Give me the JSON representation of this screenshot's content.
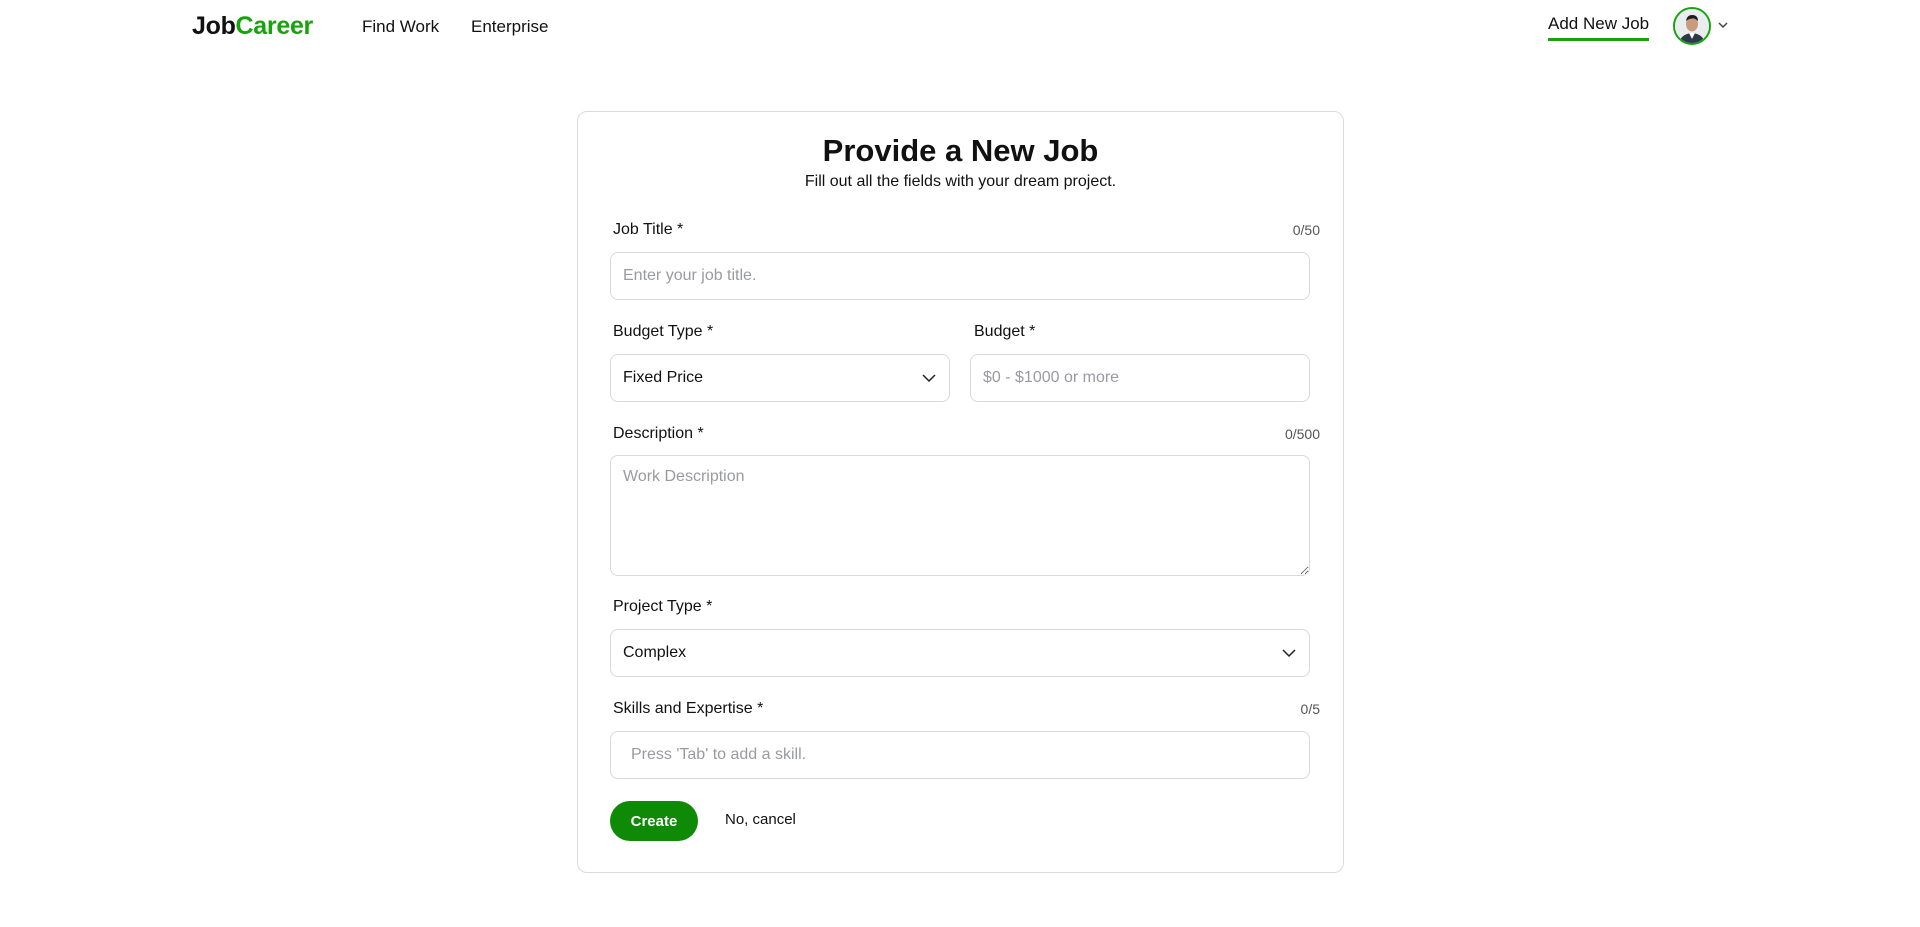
{
  "header": {
    "logo": {
      "part1": "Job",
      "part2": "Career"
    },
    "nav": [
      {
        "label": "Find Work"
      },
      {
        "label": "Enterprise"
      }
    ],
    "add_new_job": "Add New Job",
    "avatar_icon": "user-avatar",
    "accent_color": "#16a30c"
  },
  "form": {
    "title": "Provide a New Job",
    "subtitle": "Fill out all the fields with your dream project.",
    "job_title": {
      "label": "Job Title *",
      "counter": "0/50",
      "placeholder": "Enter your job title.",
      "value": ""
    },
    "budget_type": {
      "label": "Budget Type *",
      "value": "Fixed Price"
    },
    "budget": {
      "label": "Budget *",
      "placeholder": "$0 - $1000 or more",
      "value": ""
    },
    "description": {
      "label": "Description *",
      "counter": "0/500",
      "placeholder": "Work Description",
      "value": ""
    },
    "project_type": {
      "label": "Project Type *",
      "value": "Complex"
    },
    "skills": {
      "label": "Skills and Expertise *",
      "counter": "0/5",
      "placeholder": "Press 'Tab' to add a skill.",
      "value": ""
    },
    "create_label": "Create",
    "cancel_label": "No, cancel",
    "button_color": "#0e8a06"
  }
}
